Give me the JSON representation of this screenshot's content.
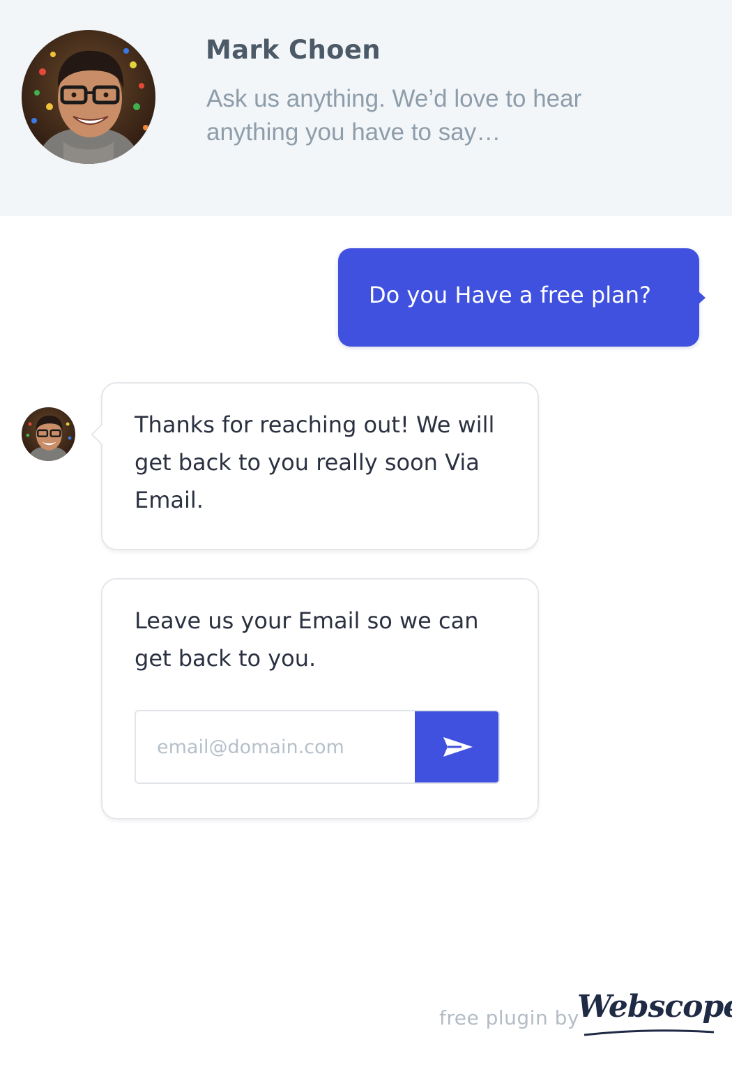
{
  "header": {
    "agent_name": "Mark Choen",
    "tagline": "Ask us anything. We’d love to hear anything you have to say…"
  },
  "messages": {
    "user_message": "Do you Have a free plan?",
    "agent_reply": "Thanks for reaching out! We will get back to you really soon Via Email.",
    "email_prompt": "Leave us your Email so we can get back to you."
  },
  "email_form": {
    "placeholder": "email@domain.com",
    "value": "",
    "send_icon": "paper-plane-icon"
  },
  "footer": {
    "label": "free plugin by",
    "brand": "Webscope"
  },
  "colors": {
    "accent": "#4051e0",
    "header_bg": "#f3f6f9",
    "name_text": "#4c5966",
    "tagline_text": "#8d9daa",
    "body_text": "#2b3140",
    "placeholder_text": "#b6c0ca",
    "footer_text": "#b3bcc5",
    "brand_text": "#1f2a44"
  }
}
